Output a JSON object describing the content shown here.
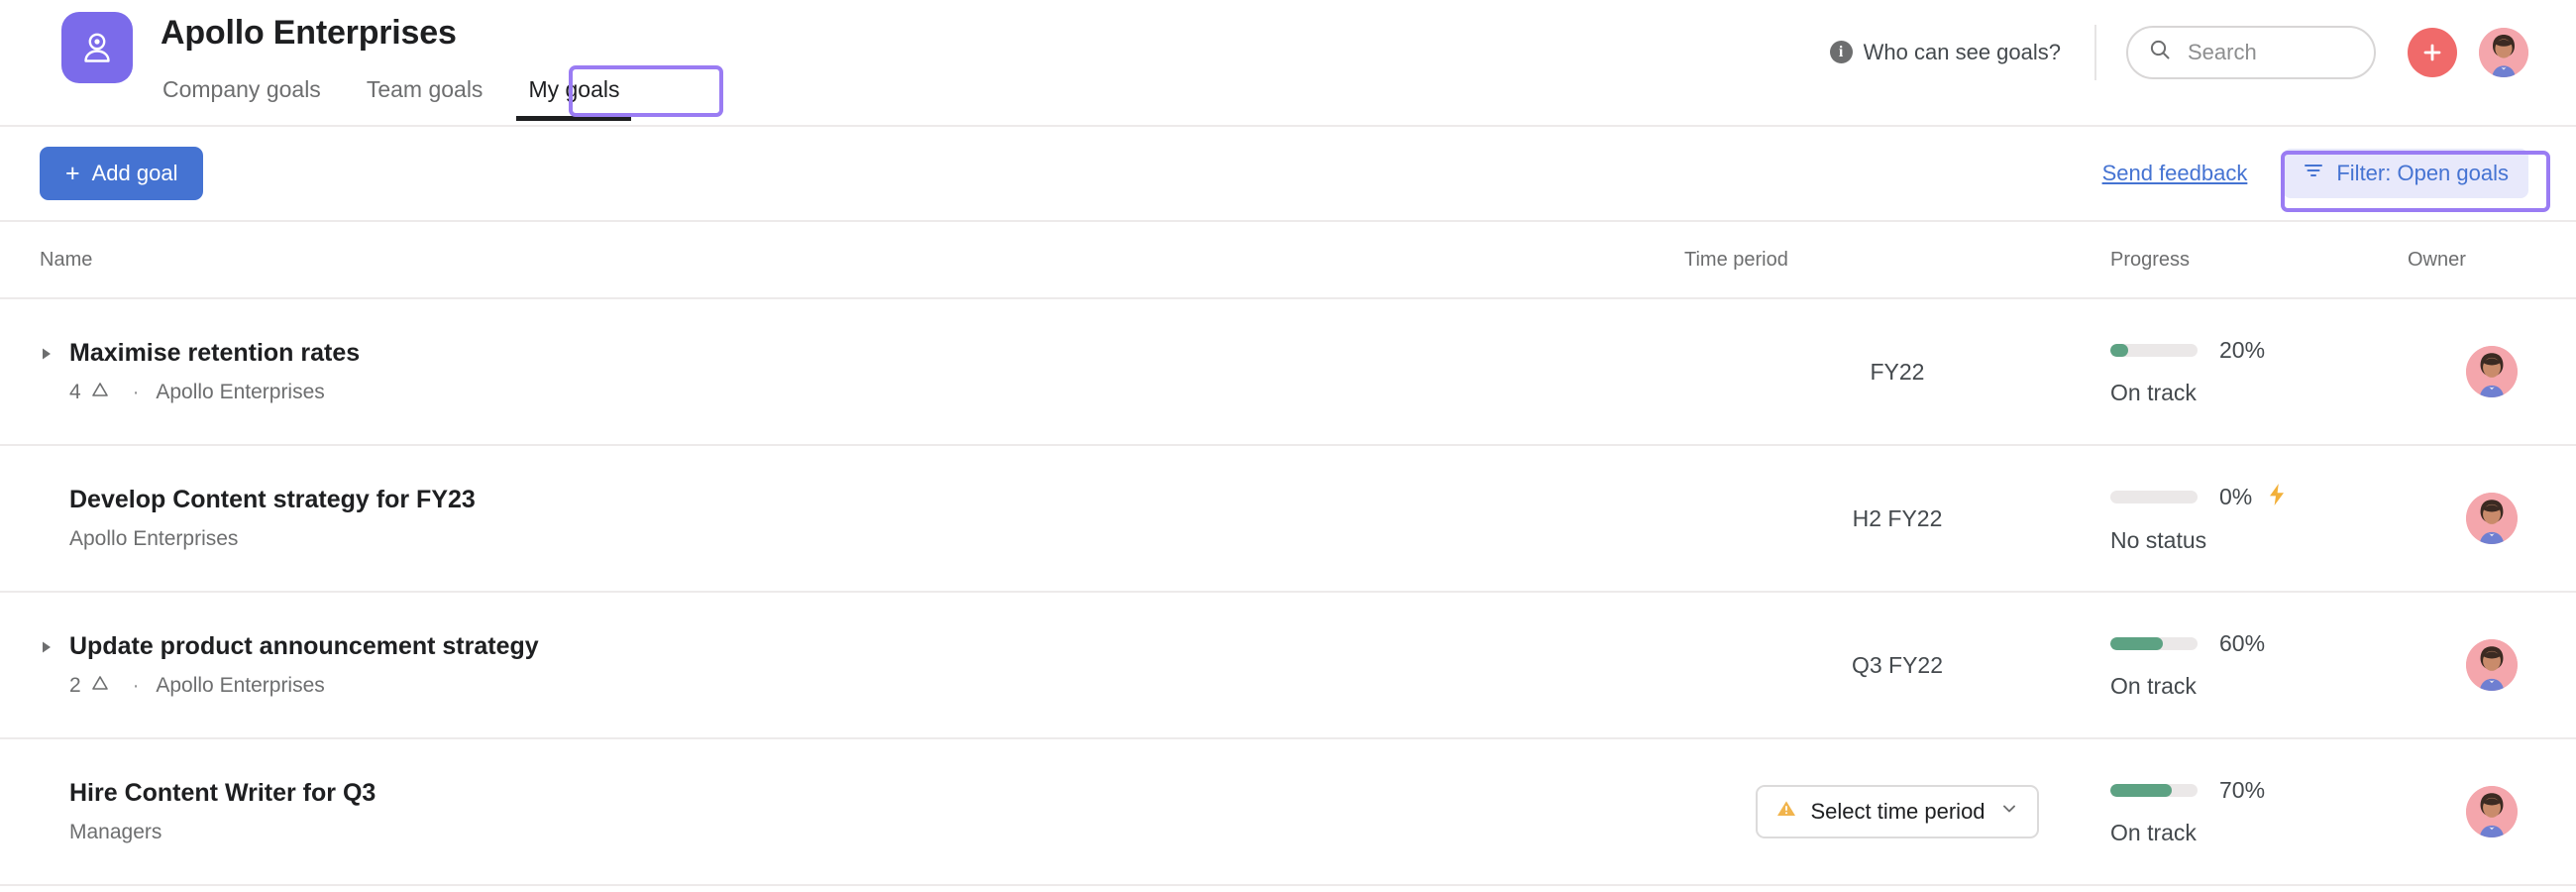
{
  "header": {
    "org_title": "Apollo Enterprises",
    "logo_icon": "person-target-icon",
    "tabs": [
      {
        "label": "Company goals",
        "active": false
      },
      {
        "label": "Team goals",
        "active": false
      },
      {
        "label": "My goals",
        "active": true
      }
    ],
    "who_can_see": "Who can see goals?",
    "info_icon": "info-icon",
    "search": {
      "placeholder": "Search",
      "value": "",
      "icon": "search-icon"
    },
    "add_button_icon": "plus-icon",
    "avatar": "user-avatar"
  },
  "toolbar": {
    "add_goal_label": "Add goal",
    "add_goal_icon": "plus-icon",
    "send_feedback_label": "Send feedback",
    "filter_label": "Filter: Open goals",
    "filter_icon": "filter-icon"
  },
  "table": {
    "columns": {
      "name": "Name",
      "time_period": "Time period",
      "progress": "Progress",
      "owner": "Owner"
    },
    "rows": [
      {
        "name": "Maximise retention rates",
        "expandable": true,
        "disclosure_icon": "triangle-right-icon",
        "subgoal_count": "4",
        "subgoal_icon": "subgoal-triangle-icon",
        "separator": "·",
        "team": "Apollo Enterprises",
        "time_period": "FY22",
        "time_period_is_select": false,
        "progress_pct": 20,
        "progress_label": "20%",
        "status": "On track",
        "has_bolt": false,
        "owner": "user-avatar"
      },
      {
        "name": "Develop Content strategy for FY23",
        "expandable": false,
        "disclosure_icon": "",
        "subgoal_count": "",
        "subgoal_icon": "",
        "separator": "",
        "team": "Apollo Enterprises",
        "time_period": "H2 FY22",
        "time_period_is_select": false,
        "progress_pct": 0,
        "progress_label": "0%",
        "status": "No status",
        "has_bolt": true,
        "bolt_icon": "lightning-bolt-icon",
        "owner": "user-avatar"
      },
      {
        "name": "Update product announcement strategy",
        "expandable": true,
        "disclosure_icon": "triangle-right-icon",
        "subgoal_count": "2",
        "subgoal_icon": "subgoal-triangle-icon",
        "separator": "·",
        "team": "Apollo Enterprises",
        "time_period": "Q3 FY22",
        "time_period_is_select": false,
        "progress_pct": 60,
        "progress_label": "60%",
        "status": "On track",
        "has_bolt": false,
        "owner": "user-avatar"
      },
      {
        "name": "Hire Content Writer for Q3",
        "expandable": false,
        "disclosure_icon": "",
        "subgoal_count": "",
        "subgoal_icon": "",
        "separator": "",
        "team": "Managers",
        "time_period": "Select time period",
        "time_period_is_select": true,
        "time_period_warn_icon": "warning-triangle-icon",
        "time_period_chevron": "chevron-down-icon",
        "progress_pct": 70,
        "progress_label": "70%",
        "status": "On track",
        "has_bolt": false,
        "owner": "user-avatar"
      }
    ]
  },
  "colors": {
    "brand_purple": "#7b6bea",
    "accent_blue": "#4573d2",
    "coral": "#f06a6a",
    "progress_green": "#5da283",
    "annotation_purple": "#9a7cf3",
    "filter_bg": "#e8e9fb",
    "warning_orange": "#f1b44c"
  }
}
